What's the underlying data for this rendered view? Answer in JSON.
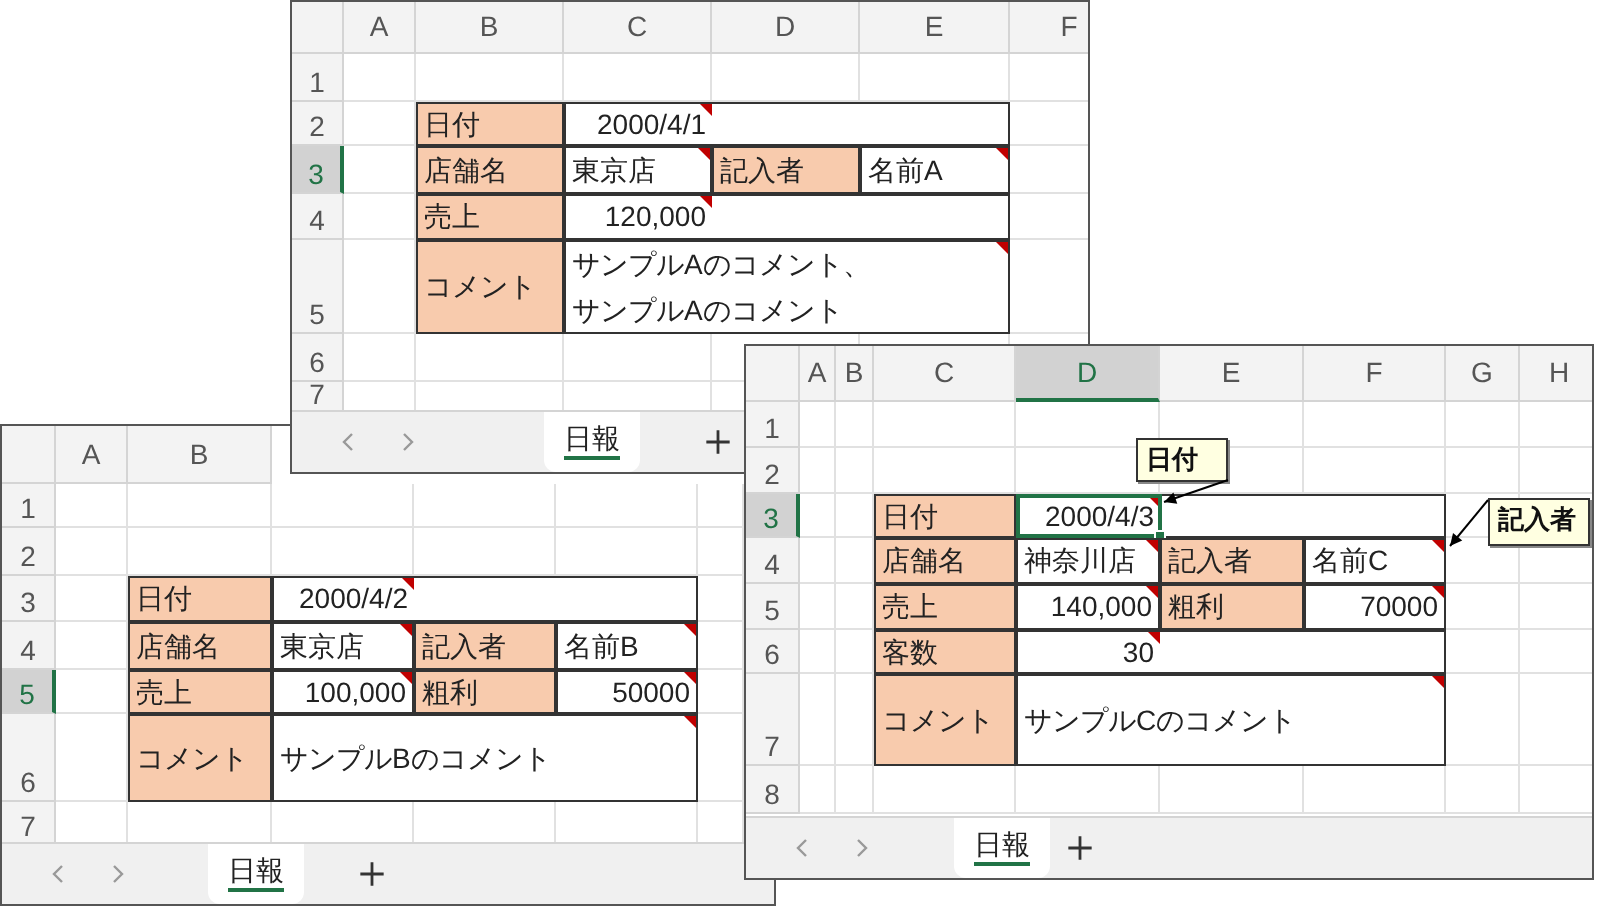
{
  "windows": [
    {
      "column_headers": [
        {
          "label": "A",
          "selected": false
        },
        {
          "label": "B",
          "selected": false
        },
        {
          "label": "C",
          "selected": false
        },
        {
          "label": "D",
          "selected": false
        },
        {
          "label": "E",
          "selected": false
        },
        {
          "label": "F",
          "selected": false
        }
      ],
      "row_headers": [
        {
          "label": "1",
          "selected": false
        },
        {
          "label": "2",
          "selected": false
        },
        {
          "label": "3",
          "selected": true
        },
        {
          "label": "4",
          "selected": false
        },
        {
          "label": "5",
          "selected": false
        },
        {
          "label": "6",
          "selected": false
        },
        {
          "label": "7",
          "selected": false
        }
      ],
      "form": [
        {
          "cells": [
            {
              "text": "日付",
              "kind": "label",
              "comment": false,
              "selected": false
            },
            {
              "text": "2000/4/1",
              "kind": "number",
              "comment": true,
              "selected": false
            }
          ]
        },
        {
          "cells": [
            {
              "text": "店舗名",
              "kind": "label",
              "comment": false,
              "selected": false
            },
            {
              "text": "東京店",
              "kind": "text",
              "comment": true,
              "selected": false
            },
            {
              "text": "記入者",
              "kind": "label",
              "comment": false,
              "selected": false
            },
            {
              "text": "名前A",
              "kind": "text",
              "comment": true,
              "selected": false
            }
          ]
        },
        {
          "cells": [
            {
              "text": "売上",
              "kind": "label",
              "comment": false,
              "selected": false
            },
            {
              "text": "120,000",
              "kind": "number",
              "comment": true,
              "selected": false
            }
          ]
        },
        {
          "cells": [
            {
              "text": "コメント",
              "kind": "label",
              "comment": false,
              "selected": false
            },
            {
              "lines": [
                "サンプルAのコメント、",
                "サンプルAのコメント"
              ],
              "kind": "text",
              "comment": true,
              "selected": false
            }
          ]
        }
      ],
      "sheet_tabs": [
        {
          "label": "日報",
          "selected": true
        }
      ]
    },
    {
      "column_headers": [
        {
          "label": "A",
          "selected": false
        },
        {
          "label": "B",
          "selected": false
        }
      ],
      "row_headers": [
        {
          "label": "1",
          "selected": false
        },
        {
          "label": "2",
          "selected": false
        },
        {
          "label": "3",
          "selected": false
        },
        {
          "label": "4",
          "selected": false
        },
        {
          "label": "5",
          "selected": true
        },
        {
          "label": "6",
          "selected": false
        },
        {
          "label": "7",
          "selected": false
        }
      ],
      "form": [
        {
          "cells": [
            {
              "text": "日付",
              "kind": "label",
              "comment": false,
              "selected": false
            },
            {
              "text": "2000/4/2",
              "kind": "number",
              "comment": true,
              "selected": false
            }
          ]
        },
        {
          "cells": [
            {
              "text": "店舗名",
              "kind": "label",
              "comment": false,
              "selected": false
            },
            {
              "text": "東京店",
              "kind": "text",
              "comment": true,
              "selected": false
            },
            {
              "text": "記入者",
              "kind": "label",
              "comment": false,
              "selected": false
            },
            {
              "text": "名前B",
              "kind": "text",
              "comment": true,
              "selected": false
            }
          ]
        },
        {
          "cells": [
            {
              "text": "売上",
              "kind": "label",
              "comment": false,
              "selected": false
            },
            {
              "text": "100,000",
              "kind": "number",
              "comment": true,
              "selected": false
            },
            {
              "text": "粗利",
              "kind": "label",
              "comment": false,
              "selected": false
            },
            {
              "text": "50000",
              "kind": "number",
              "comment": true,
              "selected": false
            }
          ]
        },
        {
          "cells": [
            {
              "text": "コメント",
              "kind": "label",
              "comment": false,
              "selected": false
            },
            {
              "text": "サンプルBのコメント",
              "kind": "text",
              "comment": true,
              "selected": false
            }
          ]
        }
      ],
      "sheet_tabs": [
        {
          "label": "日報",
          "selected": true
        }
      ]
    },
    {
      "column_headers": [
        {
          "label": "A",
          "selected": false
        },
        {
          "label": "B",
          "selected": false
        },
        {
          "label": "C",
          "selected": false
        },
        {
          "label": "D",
          "selected": true
        },
        {
          "label": "E",
          "selected": false
        },
        {
          "label": "F",
          "selected": false
        },
        {
          "label": "G",
          "selected": false
        },
        {
          "label": "H",
          "selected": false
        }
      ],
      "row_headers": [
        {
          "label": "1",
          "selected": false
        },
        {
          "label": "2",
          "selected": false
        },
        {
          "label": "3",
          "selected": true
        },
        {
          "label": "4",
          "selected": false
        },
        {
          "label": "5",
          "selected": false
        },
        {
          "label": "6",
          "selected": false
        },
        {
          "label": "7",
          "selected": false
        },
        {
          "label": "8",
          "selected": false
        }
      ],
      "form": [
        {
          "cells": [
            {
              "text": "日付",
              "kind": "label",
              "comment": false,
              "selected": false
            },
            {
              "text": "2000/4/3",
              "kind": "number",
              "comment": true,
              "selected": true
            }
          ]
        },
        {
          "cells": [
            {
              "text": "店舗名",
              "kind": "label",
              "comment": false,
              "selected": false
            },
            {
              "text": "神奈川店",
              "kind": "text",
              "comment": true,
              "selected": false
            },
            {
              "text": "記入者",
              "kind": "label",
              "comment": false,
              "selected": false
            },
            {
              "text": "名前C",
              "kind": "text",
              "comment": true,
              "selected": false
            }
          ]
        },
        {
          "cells": [
            {
              "text": "売上",
              "kind": "label",
              "comment": false,
              "selected": false
            },
            {
              "text": "140,000",
              "kind": "number",
              "comment": true,
              "selected": false
            },
            {
              "text": "粗利",
              "kind": "label",
              "comment": false,
              "selected": false
            },
            {
              "text": "70000",
              "kind": "number",
              "comment": true,
              "selected": false
            }
          ]
        },
        {
          "cells": [
            {
              "text": "客数",
              "kind": "label",
              "comment": false,
              "selected": false
            },
            {
              "text": "30",
              "kind": "number",
              "comment": true,
              "selected": false
            }
          ]
        },
        {
          "cells": [
            {
              "text": "コメント",
              "kind": "label",
              "comment": false,
              "selected": false
            },
            {
              "text": "サンプルCのコメント",
              "kind": "text",
              "comment": true,
              "selected": false
            }
          ]
        }
      ],
      "notes": [
        {
          "text": "日付"
        },
        {
          "text": "記入者"
        }
      ],
      "sheet_tabs": [
        {
          "label": "日報",
          "selected": true
        }
      ]
    }
  ]
}
